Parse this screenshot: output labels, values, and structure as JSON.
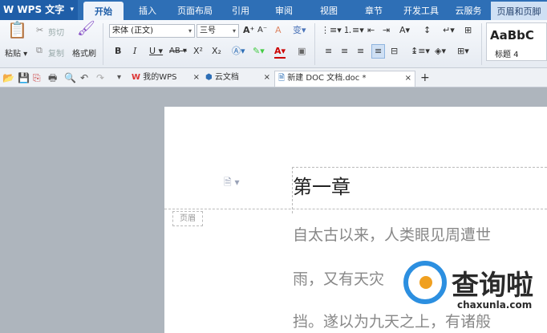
{
  "app": {
    "name": "WPS 文字",
    "menu_arrow": "▾"
  },
  "menu_tabs": [
    "开始",
    "插入",
    "页面布局",
    "引用",
    "审阅",
    "视图",
    "章节",
    "开发工具",
    "云服务",
    "页眉和页脚"
  ],
  "ribbon": {
    "paste": "粘贴",
    "cut": "剪切",
    "copy": "复制",
    "format_painter": "格式刷",
    "font_name": "宋体 (正文)",
    "font_size": "三号",
    "grow_font": "A⁺",
    "shrink_font": "A⁻",
    "bold": "B",
    "italic": "I",
    "underline": "U",
    "strike": "AB",
    "superscript": "X²",
    "subscript": "X₂",
    "font_color": "A",
    "style_preview": "AaBbC",
    "style_name": "标题 4"
  },
  "quick_access": {
    "icons": [
      "open-icon",
      "save-icon",
      "export-icon",
      "print-icon",
      "preview-icon",
      "undo-icon",
      "redo-icon"
    ]
  },
  "doc_tabs": [
    {
      "label": "我的WPS",
      "close": "×"
    },
    {
      "label": "云文档",
      "close": "×"
    },
    {
      "label": "新建 DOC 文档.doc *",
      "close": "×"
    }
  ],
  "new_tab": "+",
  "document": {
    "chapter_title": "第一章",
    "header_label": "页眉",
    "lines": [
      "自太古以来，人类眼见周遭世",
      "雨，又有天灾",
      "挡。遂以为九天之上，有诸般"
    ]
  },
  "watermark": {
    "title": "查询啦",
    "url": "chaxunla.com"
  }
}
